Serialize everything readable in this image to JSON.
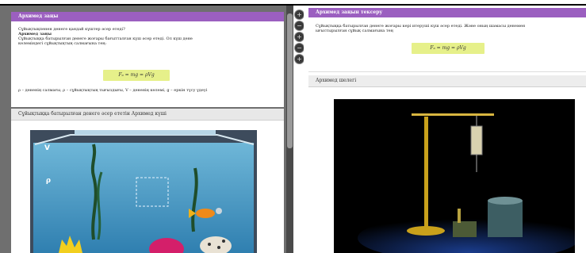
{
  "left": {
    "card1": {
      "title": "Архимед заңы",
      "question": "Сұйықтықпенен денеге қандай күштер әсер етеді?",
      "subheading": "Архимед заңы",
      "line1": "Сұйықтыққа батырылған денеге жоғары бағытталған күш әсер етеді. Ол күш дене",
      "line2": "көлеміндегі сұйықтықтың салмағына тең:",
      "formula": "Fₐ = mg = ρVg",
      "legend": "ρ – дененің салмағы, ρ – сұйықтықтың тығыздығы, V – дененің көлемі, g – еркін түсу үдеуі"
    },
    "card2": {
      "title": "Сұйықтыққа батырылған денеге әсер ететін Архимед күші",
      "label_v": "V",
      "label_rho": "ρ"
    }
  },
  "side_buttons": [
    "+",
    "−",
    "+",
    "−",
    "+"
  ],
  "right": {
    "card1": {
      "title": "Архимед заңын тексеру",
      "line1": "Сұйықтыққа батырылған денеге жоғары кері итеруші күш әсер етеді. Және оның шамасы денемен",
      "line2": "ығыстырылған сұйық салмағына тең",
      "formula": "Fₐ = mg = ρVg"
    },
    "card2": {
      "title": "Архимед шелегі"
    }
  }
}
